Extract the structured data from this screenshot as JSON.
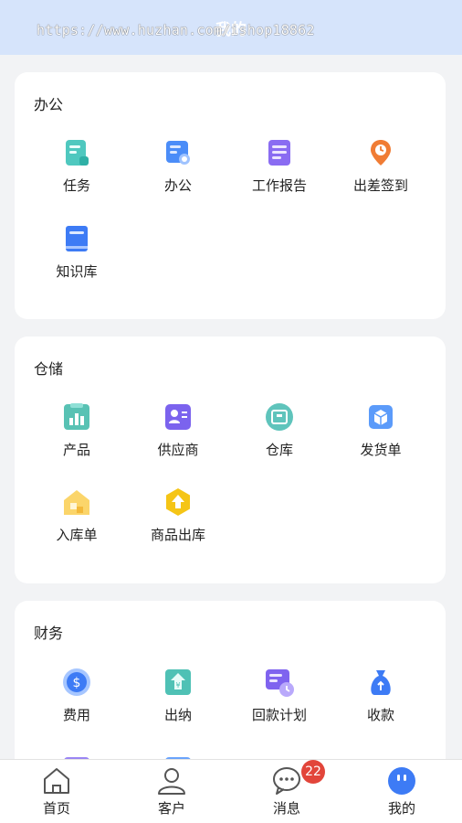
{
  "header": {
    "title": "我的",
    "watermark": "https://www.huzhan.com/ishop18862"
  },
  "sections": [
    {
      "title": "办公",
      "items": [
        {
          "label": "任务",
          "icon": "task-doc-icon"
        },
        {
          "label": "办公",
          "icon": "office-search-icon"
        },
        {
          "label": "工作报告",
          "icon": "work-report-icon"
        },
        {
          "label": "出差签到",
          "icon": "location-pin-icon"
        },
        {
          "label": "知识库",
          "icon": "knowledge-book-icon"
        }
      ]
    },
    {
      "title": "仓储",
      "items": [
        {
          "label": "产品",
          "icon": "product-chart-icon"
        },
        {
          "label": "供应商",
          "icon": "supplier-card-icon"
        },
        {
          "label": "仓库",
          "icon": "warehouse-icon"
        },
        {
          "label": "发货单",
          "icon": "delivery-box-icon"
        },
        {
          "label": "入库单",
          "icon": "inbound-house-icon"
        },
        {
          "label": "商品出库",
          "icon": "outbound-arrow-icon"
        }
      ]
    },
    {
      "title": "财务",
      "items": [
        {
          "label": "费用",
          "icon": "dollar-coin-icon"
        },
        {
          "label": "出纳",
          "icon": "cashier-icon"
        },
        {
          "label": "回款计划",
          "icon": "payback-plan-icon"
        },
        {
          "label": "收款",
          "icon": "money-bag-icon"
        }
      ]
    }
  ],
  "tabbar": {
    "items": [
      {
        "label": "首页",
        "icon": "home-icon"
      },
      {
        "label": "客户",
        "icon": "customer-icon"
      },
      {
        "label": "消息",
        "icon": "message-icon"
      },
      {
        "label": "我的",
        "icon": "profile-face-icon"
      }
    ],
    "message_badge": "22"
  },
  "colors": {
    "header_bg": "#d6e4fb",
    "accent_blue": "#3d7bf5",
    "badge_red": "#e2453a",
    "page_bg": "#f2f3f5"
  }
}
